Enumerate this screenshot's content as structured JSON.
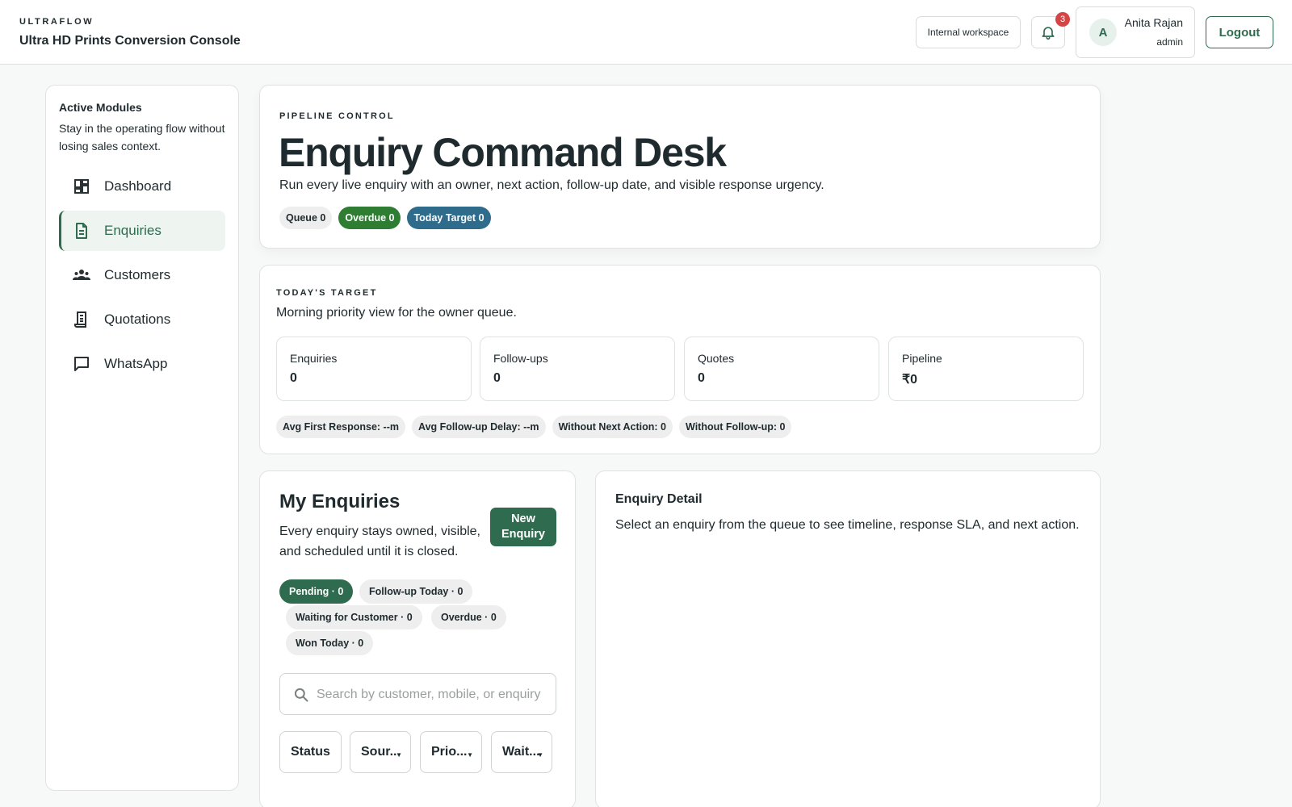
{
  "header": {
    "kicker": "ULTRAFLOW",
    "title": "Ultra HD Prints Conversion Console",
    "workspace": "Internal workspace",
    "notifications_count": "3",
    "user": {
      "initial": "A",
      "name": "Anita Rajan",
      "role": "admin"
    },
    "logout_label": "Logout"
  },
  "sidebar": {
    "title": "Active Modules",
    "description": "Stay in the operating flow without losing sales context.",
    "items": [
      {
        "label": "Dashboard",
        "icon": "dashboard-icon",
        "active": false
      },
      {
        "label": "Enquiries",
        "icon": "document-icon",
        "active": true
      },
      {
        "label": "Customers",
        "icon": "people-icon",
        "active": false
      },
      {
        "label": "Quotations",
        "icon": "receipt-icon",
        "active": false
      },
      {
        "label": "WhatsApp",
        "icon": "chat-icon",
        "active": false
      }
    ]
  },
  "hero": {
    "kicker": "PIPELINE CONTROL",
    "title": "Enquiry Command Desk",
    "subtitle": "Run every live enquiry with an owner, next action, follow-up date, and visible response urgency.",
    "pills": [
      {
        "label": "Queue 0",
        "style": "neutral"
      },
      {
        "label": "Overdue 0",
        "style": "green"
      },
      {
        "label": "Today Target 0",
        "style": "blue"
      }
    ]
  },
  "target": {
    "kicker": "TODAY'S TARGET",
    "subtitle": "Morning priority view for the owner queue.",
    "stats": [
      {
        "label": "Enquiries",
        "value": "0"
      },
      {
        "label": "Follow-ups",
        "value": "0"
      },
      {
        "label": "Quotes",
        "value": "0"
      },
      {
        "label": "Pipeline",
        "value": "₹0"
      }
    ],
    "metrics": [
      "Avg First Response: --m",
      "Avg Follow-up Delay: --m",
      "Without Next Action: 0",
      "Without Follow-up: 0"
    ]
  },
  "enquiries": {
    "title": "My Enquiries",
    "subtitle": "Every enquiry stays owned, visible, and scheduled until it is closed.",
    "new_button": "New Enquiry",
    "filters": [
      "Pending · 0",
      "Follow-up Today · 0",
      "Waiting for Customer · 0",
      "Overdue · 0",
      "Won Today · 0"
    ],
    "search_placeholder": "Search by customer, mobile, or enquiry",
    "selects": [
      "Status",
      "Sour...",
      "Prio...",
      "Wait..."
    ]
  },
  "detail": {
    "title": "Enquiry Detail",
    "subtitle": "Select an enquiry from the queue to see timeline, response SLA, and next action."
  },
  "colors": {
    "accent": "#2f6b4f",
    "overdue": "#2e7d32",
    "target": "#2f6b8a",
    "badge": "#d64545"
  }
}
